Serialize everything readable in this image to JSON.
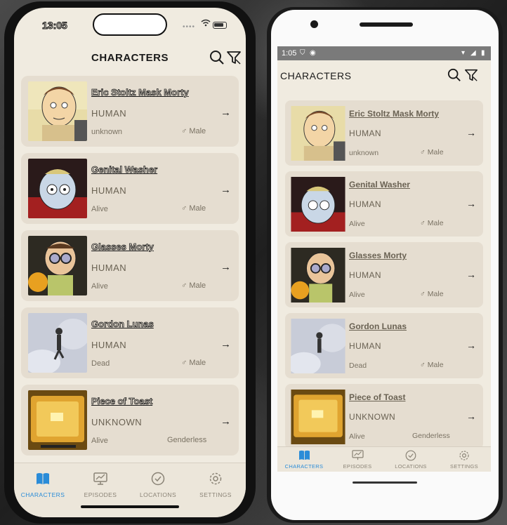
{
  "ios": {
    "time": "13:05",
    "title": "CHARACTERS",
    "characters": [
      {
        "name": "Eric Stoltz Mask Morty",
        "species": "HUMAN",
        "status": "unknown",
        "gender": "Male",
        "gender_icon": "male-icon"
      },
      {
        "name": "Genital Washer",
        "species": "HUMAN",
        "status": "Alive",
        "gender": "Male",
        "gender_icon": "male-icon"
      },
      {
        "name": "Glasses Morty",
        "species": "HUMAN",
        "status": "Alive",
        "gender": "Male",
        "gender_icon": "male-icon"
      },
      {
        "name": "Gordon Lunas",
        "species": "HUMAN",
        "status": "Dead",
        "gender": "Male",
        "gender_icon": "male-icon"
      },
      {
        "name": "Piece of Toast",
        "species": "UNKNOWN",
        "status": "Alive",
        "gender": "Genderless",
        "gender_icon": ""
      }
    ],
    "tabs": [
      {
        "label": "CHARACTERS",
        "icon": "book-icon",
        "active": true
      },
      {
        "label": "EPISODES",
        "icon": "monitor-icon",
        "active": false
      },
      {
        "label": "LOCATIONS",
        "icon": "check-badge-icon",
        "active": false
      },
      {
        "label": "SETTINGS",
        "icon": "gear-icon",
        "active": false
      }
    ]
  },
  "android": {
    "time": "1:05",
    "title": "CHARACTERS",
    "characters": [
      {
        "name": "Eric Stoltz Mask Morty",
        "species": "HUMAN",
        "status": "unknown",
        "gender": "Male",
        "gender_icon": "male-icon"
      },
      {
        "name": "Genital Washer",
        "species": "HUMAN",
        "status": "Alive",
        "gender": "Male",
        "gender_icon": "male-icon"
      },
      {
        "name": "Glasses Morty",
        "species": "HUMAN",
        "status": "Alive",
        "gender": "Male",
        "gender_icon": "male-icon"
      },
      {
        "name": "Gordon Lunas",
        "species": "HUMAN",
        "status": "Dead",
        "gender": "Male",
        "gender_icon": "male-icon"
      },
      {
        "name": "Piece of Toast",
        "species": "UNKNOWN",
        "status": "Alive",
        "gender": "Genderless",
        "gender_icon": ""
      }
    ],
    "tabs": [
      {
        "label": "CHARACTERS",
        "icon": "book-icon",
        "active": true
      },
      {
        "label": "EPISODES",
        "icon": "monitor-icon",
        "active": false
      },
      {
        "label": "LOCATIONS",
        "icon": "check-badge-icon",
        "active": false
      },
      {
        "label": "SETTINGS",
        "icon": "gear-icon",
        "active": false
      }
    ]
  },
  "colors": {
    "accent": "#2a8cd8",
    "background": "#f0ebe0",
    "card": "#e5ddd0",
    "text_muted": "#6a6253"
  },
  "arrow_glyph": "→"
}
